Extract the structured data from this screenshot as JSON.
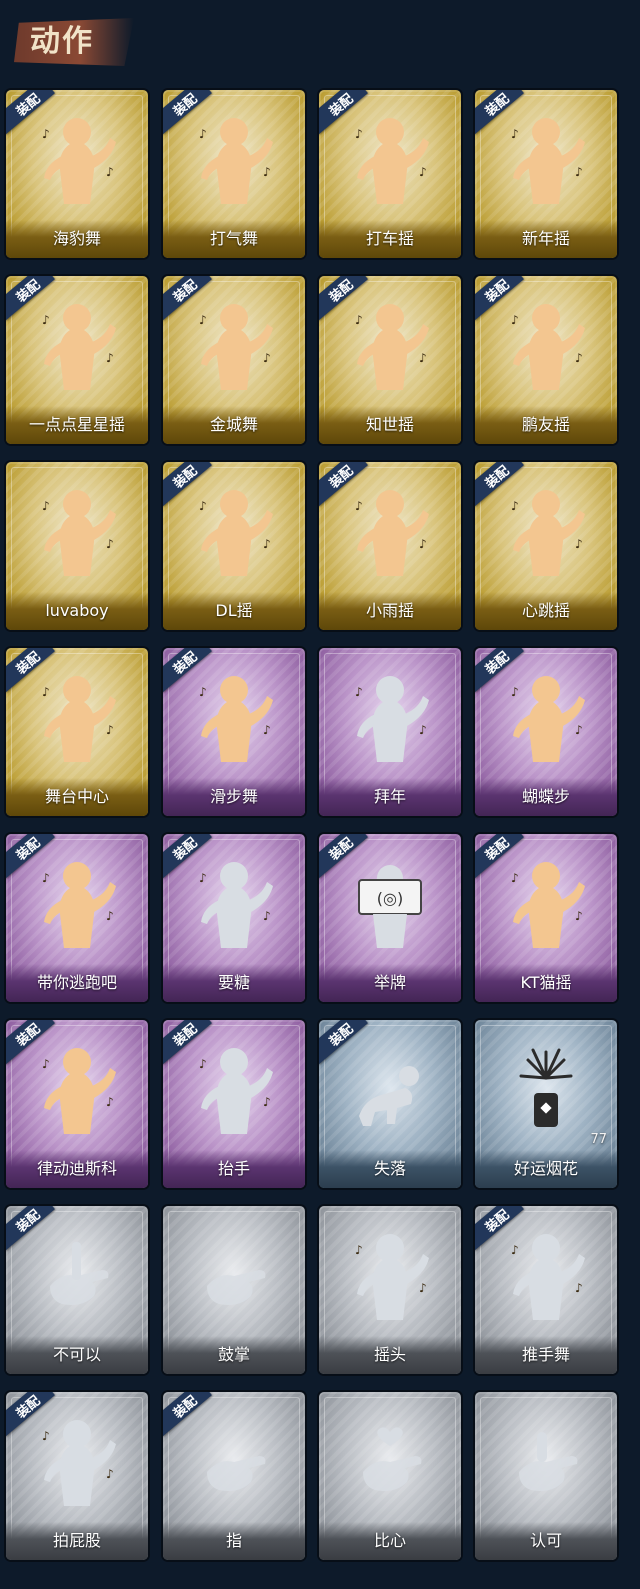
{
  "header": {
    "title": "动作"
  },
  "badge_label": "装配",
  "colors": {
    "gold": "#c7ab3c",
    "purple": "#a77ab9",
    "blue": "#8aa0b3",
    "gray": "#a6abb2",
    "badge": "#22375a",
    "figure_gold": "#f3c690",
    "figure_gray": "#d8dde3"
  },
  "cards": [
    {
      "label": "海豹舞",
      "tier": "gold",
      "equipped": true,
      "icon": "dance-figure-icon"
    },
    {
      "label": "打气舞",
      "tier": "gold",
      "equipped": true,
      "icon": "dance-figure-icon"
    },
    {
      "label": "打车摇",
      "tier": "gold",
      "equipped": true,
      "icon": "dance-figure-icon"
    },
    {
      "label": "新年摇",
      "tier": "gold",
      "equipped": true,
      "icon": "dance-figure-icon"
    },
    {
      "label": "一点点星星摇",
      "tier": "gold",
      "equipped": true,
      "icon": "dance-figure-icon"
    },
    {
      "label": "金城舞",
      "tier": "gold",
      "equipped": true,
      "icon": "dance-figure-icon"
    },
    {
      "label": "知世摇",
      "tier": "gold",
      "equipped": true,
      "icon": "dance-figure-icon"
    },
    {
      "label": "鹏友摇",
      "tier": "gold",
      "equipped": true,
      "icon": "dance-figure-icon"
    },
    {
      "label": "luvaboy",
      "tier": "gold",
      "equipped": false,
      "icon": "dance-figure-icon"
    },
    {
      "label": "DL摇",
      "tier": "gold",
      "equipped": true,
      "icon": "dance-figure-icon"
    },
    {
      "label": "小雨摇",
      "tier": "gold",
      "equipped": true,
      "icon": "dance-figure-icon"
    },
    {
      "label": "心跳摇",
      "tier": "gold",
      "equipped": true,
      "icon": "dance-figure-icon"
    },
    {
      "label": "舞台中心",
      "tier": "gold",
      "equipped": true,
      "icon": "dance-figure-icon"
    },
    {
      "label": "滑步舞",
      "tier": "purple",
      "equipped": true,
      "icon": "dance-figure-icon"
    },
    {
      "label": "拜年",
      "tier": "purple",
      "equipped": false,
      "icon": "bow-figure-icon"
    },
    {
      "label": "蝴蝶步",
      "tier": "purple",
      "equipped": true,
      "icon": "dance-figure-icon"
    },
    {
      "label": "带你逃跑吧",
      "tier": "purple",
      "equipped": true,
      "icon": "dance-figure-icon"
    },
    {
      "label": "要糖",
      "tier": "purple",
      "equipped": true,
      "icon": "ask-figure-icon"
    },
    {
      "label": "举牌",
      "tier": "purple",
      "equipped": true,
      "icon": "sign-figure-icon"
    },
    {
      "label": "KT猫摇",
      "tier": "purple",
      "equipped": true,
      "icon": "dance-figure-icon"
    },
    {
      "label": "律动迪斯科",
      "tier": "purple",
      "equipped": true,
      "icon": "dance-figure-icon"
    },
    {
      "label": "抬手",
      "tier": "purple",
      "equipped": true,
      "icon": "raise-hand-figure-icon"
    },
    {
      "label": "失落",
      "tier": "blue",
      "equipped": true,
      "icon": "crawl-figure-icon"
    },
    {
      "label": "好运烟花",
      "tier": "blue",
      "equipped": false,
      "icon": "firework-icon",
      "count": "77"
    },
    {
      "label": "不可以",
      "tier": "gray",
      "equipped": true,
      "icon": "finger-wag-icon"
    },
    {
      "label": "鼓掌",
      "tier": "gray",
      "equipped": false,
      "icon": "clap-icon"
    },
    {
      "label": "摇头",
      "tier": "gray",
      "equipped": false,
      "icon": "head-shake-figure-icon"
    },
    {
      "label": "推手舞",
      "tier": "gray",
      "equipped": true,
      "icon": "push-hand-figure-icon"
    },
    {
      "label": "拍屁股",
      "tier": "gray",
      "equipped": true,
      "icon": "butt-pat-figure-icon"
    },
    {
      "label": "指",
      "tier": "gray",
      "equipped": true,
      "icon": "point-hand-icon"
    },
    {
      "label": "比心",
      "tier": "gray",
      "equipped": false,
      "icon": "finger-heart-icon"
    },
    {
      "label": "认可",
      "tier": "gray",
      "equipped": false,
      "icon": "thumbs-up-icon"
    }
  ]
}
